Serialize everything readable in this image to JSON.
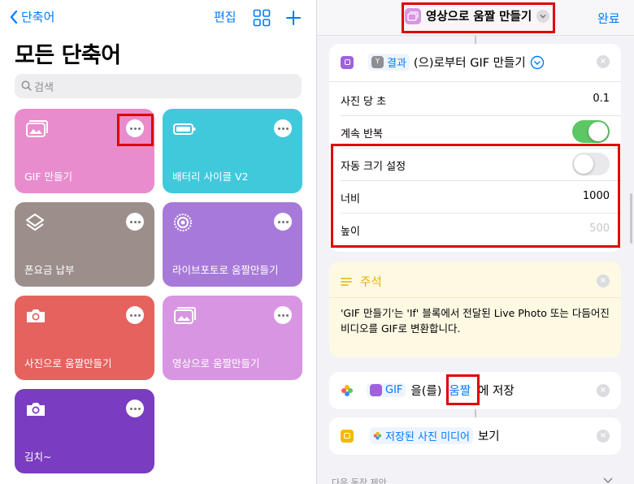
{
  "left": {
    "back_label": "단축어",
    "edit_label": "편집",
    "title": "모든 단축어",
    "search_placeholder": "검색",
    "cards": [
      {
        "label": "GIF 만들기",
        "icon": "photo-stack-icon",
        "color": "#e88ccd"
      },
      {
        "label": "배터리 사이클 V2",
        "icon": "battery-icon",
        "color": "#3fc9db"
      },
      {
        "label": "폰요금 납부",
        "icon": "layers-icon",
        "color": "#9c8f8b"
      },
      {
        "label": "라이브포토로 움짤만들기",
        "icon": "live-photo-icon",
        "color": "#a77ad9"
      },
      {
        "label": "사진으로 움짤만들기",
        "icon": "camera-icon",
        "color": "#e5625e"
      },
      {
        "label": "영상으로 움짤만들기",
        "icon": "photo-stack-icon",
        "color": "#d895e2"
      },
      {
        "label": "김치~",
        "icon": "camera-icon",
        "color": "#7a3cc0"
      }
    ]
  },
  "right": {
    "header_title": "영상으로 움짤 만들기",
    "done_label": "완료",
    "gif_action": {
      "result_chip": "결과",
      "text": "(으)로부터 GIF 만들기",
      "rows": [
        {
          "label": "사진 당 초",
          "value": "0.1"
        },
        {
          "label": "계속 반복"
        },
        {
          "label": "자동 크기 설정"
        },
        {
          "label": "너비",
          "value": "1000"
        },
        {
          "label": "높이",
          "value": "500"
        }
      ],
      "loop_on": true,
      "auto_size_on": false
    },
    "comment": {
      "title": "주석",
      "text": "'GIF 만들기'는 'If' 블록에서 전달된 Live Photo 또는 다듬어진 비디오를 GIF로 변환합니다."
    },
    "save_action": {
      "gif_chip": "GIF",
      "text_mid": "을(를)",
      "album_chip": "움짤",
      "text_end": "에 저장"
    },
    "show_action": {
      "chip": "저장된 사진 미디어",
      "text": "보기"
    },
    "next_suggest": "다음 동작 제안"
  }
}
